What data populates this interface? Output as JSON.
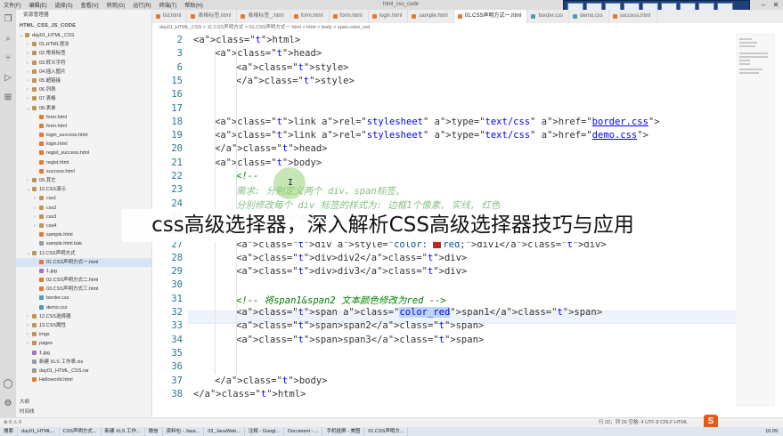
{
  "window": {
    "title": "html_css_code",
    "menu": [
      "文件(F)",
      "编辑(E)",
      "选择(S)",
      "查看(V)",
      "转到(G)",
      "运行(R)",
      "终端(T)",
      "帮助(H)"
    ]
  },
  "sidebar": {
    "header": "资源管理器",
    "root": "HTML_CSS_JS_CODE",
    "items": [
      {
        "label": "day01_HTML_CSS",
        "kind": "folder",
        "open": true
      },
      {
        "label": "01.HTML语法",
        "kind": "folder"
      },
      {
        "label": "02.常用标签",
        "kind": "folder"
      },
      {
        "label": "03.转义字符",
        "kind": "folder"
      },
      {
        "label": "04.插入图片",
        "kind": "folder"
      },
      {
        "label": "05.超链接",
        "kind": "folder"
      },
      {
        "label": "06.列表",
        "kind": "folder"
      },
      {
        "label": "07.表格",
        "kind": "folder"
      },
      {
        "label": "08.表单",
        "kind": "folder",
        "open": true
      },
      {
        "label": "form.html",
        "kind": "html"
      },
      {
        "label": "form.html",
        "kind": "html"
      },
      {
        "label": "login_success.html",
        "kind": "html"
      },
      {
        "label": "login.html",
        "kind": "html"
      },
      {
        "label": "regist_success.html",
        "kind": "html"
      },
      {
        "label": "regist.html",
        "kind": "html"
      },
      {
        "label": "success.html",
        "kind": "html"
      },
      {
        "label": "09.其它",
        "kind": "folder"
      },
      {
        "label": "10.CSS演示",
        "kind": "folder",
        "open": true
      },
      {
        "label": "css1",
        "kind": "folder"
      },
      {
        "label": "css2",
        "kind": "folder"
      },
      {
        "label": "css3",
        "kind": "folder"
      },
      {
        "label": "css4",
        "kind": "folder"
      },
      {
        "label": "sample.html",
        "kind": "html"
      },
      {
        "label": "sample.html.bak",
        "kind": "file"
      },
      {
        "label": "11.CSS声明方式",
        "kind": "folder",
        "open": true
      },
      {
        "label": "01.CSS声明方式一.html",
        "kind": "html",
        "selected": true
      },
      {
        "label": "1.jpg",
        "kind": "image"
      },
      {
        "label": "02.CSS声明方式二.html",
        "kind": "html"
      },
      {
        "label": "03.CSS声明方式三.html",
        "kind": "html"
      },
      {
        "label": "border.css",
        "kind": "css"
      },
      {
        "label": "demo.css",
        "kind": "css"
      },
      {
        "label": "12.CSS选择器",
        "kind": "folder"
      },
      {
        "label": "13.CSS属性",
        "kind": "folder"
      },
      {
        "label": "imgs",
        "kind": "folder"
      },
      {
        "label": "pages",
        "kind": "folder"
      },
      {
        "label": "1.jpg",
        "kind": "image"
      },
      {
        "label": "新建 XLS 工作表.xls",
        "kind": "file"
      },
      {
        "label": "day01_HTML_CSS.rar",
        "kind": "file"
      },
      {
        "label": "Helloworld.html",
        "kind": "html"
      }
    ],
    "bottom": [
      "大纲",
      "时间线"
    ]
  },
  "tabs": [
    {
      "label": "list.html",
      "active": false
    },
    {
      "label": "表格标签.html",
      "active": false
    },
    {
      "label": "表格标签_.html",
      "active": false
    },
    {
      "label": "form.html",
      "active": false
    },
    {
      "label": "form.html",
      "active": false
    },
    {
      "label": "login.html",
      "active": false
    },
    {
      "label": "sample.html",
      "active": false
    },
    {
      "label": "01.CSS声明方式一.html",
      "active": true
    },
    {
      "label": "border.css",
      "active": false
    },
    {
      "label": "demo.css",
      "active": false
    },
    {
      "label": "success.html",
      "active": false
    }
  ],
  "breadcrumb": "day01_HTML_CSS > 11.CSS声明方式 > 01.CSS声明方式一.html > html > body > span.color_red",
  "subtitle": "css高级选择器，深入解析CSS高级选择器技巧与应用",
  "code": {
    "lines": [
      {
        "n": "2",
        "text": "<html>"
      },
      {
        "n": "3",
        "text": "<head>"
      },
      {
        "n": "6",
        "text": "<style>"
      },
      {
        "n": "15",
        "text": "</style>"
      },
      {
        "n": "16",
        "text": ""
      },
      {
        "n": "17",
        "text": ""
      },
      {
        "n": "18",
        "text": "<link rel=\"stylesheet\" type=\"text/css\" href=\"border.css\">"
      },
      {
        "n": "19",
        "text": "<link rel=\"stylesheet\" type=\"text/css\" href=\"demo.css\">"
      },
      {
        "n": "20",
        "text": "</head>"
      },
      {
        "n": "21",
        "text": "<body>"
      },
      {
        "n": "22",
        "text": "<!--"
      },
      {
        "n": "23",
        "text": "需求: 分别定义两个 div、span标签,"
      },
      {
        "n": "24",
        "text": "分别修改每个 div 标签的样式为: 边框1个像素, 实线, 红色"
      },
      {
        "n": "25",
        "text": "修改span的字体颜色为红色。"
      },
      {
        "n": "26",
        "text": "-->"
      },
      {
        "n": "27",
        "text": "<div style=\"color: red;\">div1</div>"
      },
      {
        "n": "28",
        "text": "<div>div2</div>"
      },
      {
        "n": "29",
        "text": "<div>div3</div>"
      },
      {
        "n": "30",
        "text": ""
      },
      {
        "n": "31",
        "text": "<!-- 将span1&span2 文本颜色修改为red -->"
      },
      {
        "n": "32",
        "text": "<span class=\"color_red\">span1</span>"
      },
      {
        "n": "33",
        "text": "<span>span2</span>"
      },
      {
        "n": "34",
        "text": "<span>span3</span>"
      },
      {
        "n": "35",
        "text": ""
      },
      {
        "n": "36",
        "text": ""
      },
      {
        "n": "37",
        "text": "</body>"
      },
      {
        "n": "38",
        "text": "</html>"
      }
    ]
  },
  "statusbar": {
    "left": "⊗ 0 ⚠ 0",
    "right": "行 32，列 26   空格: 4   UTF-8   CRLF   HTML"
  },
  "taskbar": {
    "items": [
      "搜索",
      "day01_HTML...",
      "CSS声明方式...",
      "新建 XLS 工作...",
      "微信",
      "资料包 - Java...",
      "03_JavaWeb...",
      "注释 - Googl...",
      "Document - ...",
      "手机投屏 - 美图",
      "01.CSS声明方..."
    ],
    "time": "16:09"
  },
  "colors": {
    "accent": "#0066b8",
    "red_swatch": "#d01c1c"
  }
}
